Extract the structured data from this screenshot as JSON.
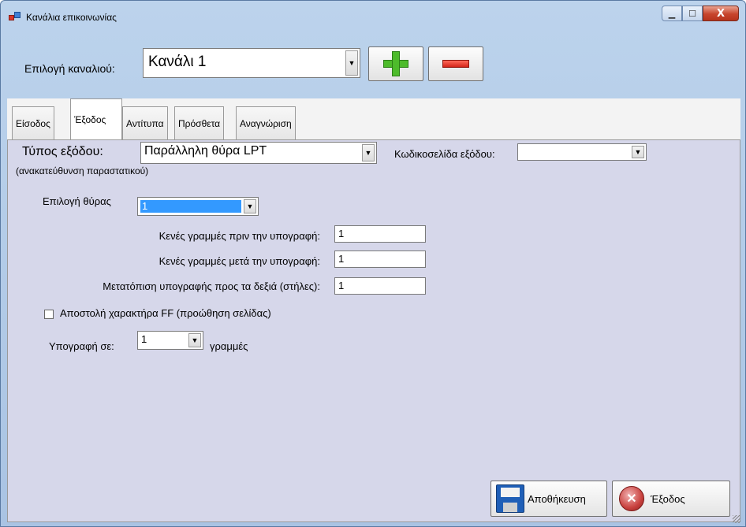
{
  "window": {
    "title": "Κανάλια επικοινωνίας",
    "controls": {
      "minimize": "▁",
      "maximize": "☐",
      "close": "X"
    }
  },
  "channel": {
    "label": "Επιλογή καναλιού:",
    "selected": "Κανάλι 1",
    "add_icon": "plus-icon",
    "remove_icon": "minus-icon"
  },
  "tabs": [
    {
      "label": "Είσοδος",
      "active": false
    },
    {
      "label": "Έξοδος",
      "active": true
    },
    {
      "label": "Αντίτυπα",
      "active": false
    },
    {
      "label": "Πρόσθετα",
      "active": false
    },
    {
      "label": "Αναγνώριση",
      "active": false
    }
  ],
  "output": {
    "type_label": "Τύπος εξόδου:",
    "type_sublabel": "(ανακατεύθυνση παραστατικού)",
    "type_value": "Παράλληλη θύρα LPT",
    "codepage_label": "Κωδικοσελίδα εξόδου:",
    "codepage_value": "",
    "port_label": "Επιλογή θύρας",
    "port_value": "1",
    "blank_before_label": "Κενές γραμμές πριν την υπογραφή:",
    "blank_before_value": "1",
    "blank_after_label": "Κενές γραμμές μετά την υπογραφή:",
    "blank_after_value": "1",
    "shift_label": "Μετατόπιση υπογραφής προς τα δεξιά (στήλες):",
    "shift_value": "1",
    "ff_label": "Αποστολή χαρακτήρα FF (προώθηση σελίδας)",
    "ff_checked": false,
    "signature_label": "Υπογραφή σε:",
    "signature_value": "1",
    "signature_unit": "γραμμές"
  },
  "buttons": {
    "save": "Αποθήκευση",
    "exit": "Έξοδος"
  },
  "icons": {
    "dropdown": "▼"
  },
  "colors": {
    "window_frame": "#bcd3ec",
    "tab_page": "#d6d7ea",
    "selection": "#3399ff"
  }
}
